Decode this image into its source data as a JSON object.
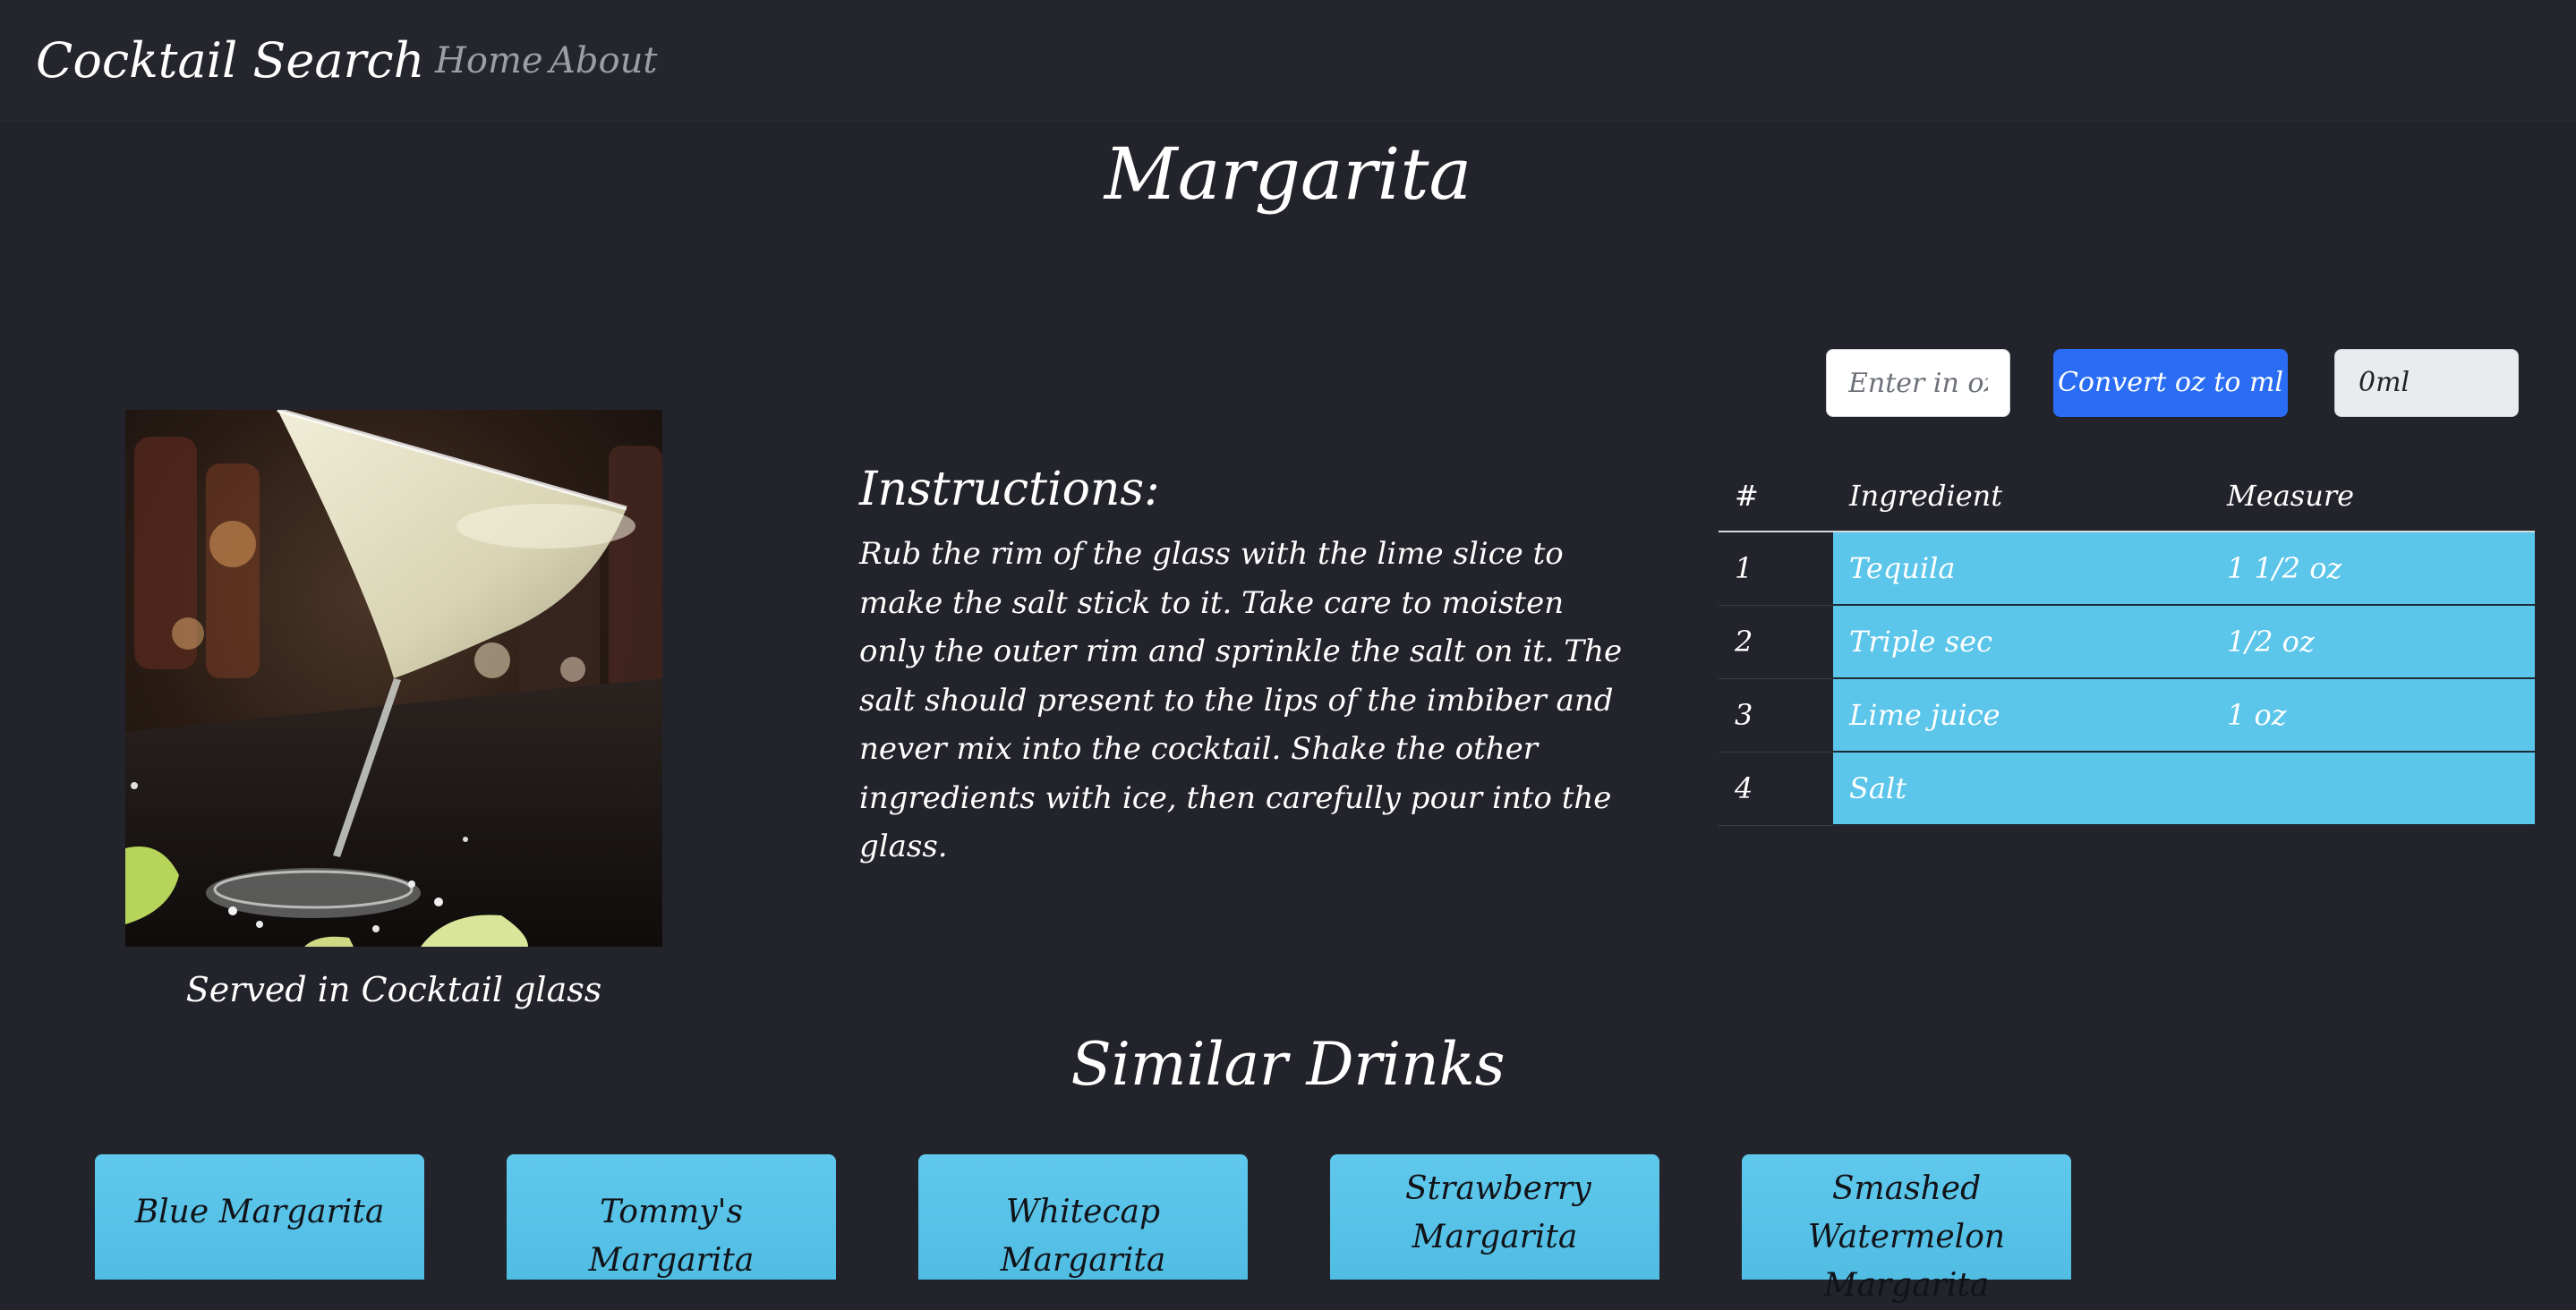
{
  "navbar": {
    "brand": "Cocktail Search",
    "links": [
      "Home",
      "About"
    ]
  },
  "drink": {
    "name": "Margarita",
    "served_in": "Served in Cocktail glass",
    "image_alt": "Margarita in cocktail glass"
  },
  "converter": {
    "input_placeholder": "Enter in oz",
    "button_label": "Convert oz to ml",
    "output_value": "0ml"
  },
  "instructions": {
    "heading": "Instructions:",
    "text": "Rub the rim of the glass with the lime slice to make the salt stick to it. Take care to moisten only the outer rim and sprinkle the salt on it. The salt should present to the lips of the imbiber and never mix into the cocktail. Shake the other ingredients with ice, then carefully pour into the glass."
  },
  "ingredients_table": {
    "headers": [
      "#",
      "Ingredient",
      "Measure"
    ],
    "rows": [
      {
        "num": "1",
        "ingredient": "Tequila",
        "measure": "1 1/2 oz"
      },
      {
        "num": "2",
        "ingredient": "Triple sec",
        "measure": "1/2 oz"
      },
      {
        "num": "3",
        "ingredient": "Lime juice",
        "measure": "1 oz"
      },
      {
        "num": "4",
        "ingredient": "Salt",
        "measure": ""
      }
    ]
  },
  "similar": {
    "heading": "Similar Drinks",
    "drinks": [
      "Blue Margarita",
      "Tommy's Margarita",
      "Whitecap Margarita",
      "Strawberry Margarita",
      "Smashed Watermelon Margarita"
    ]
  },
  "colors": {
    "background": "#22232b",
    "navbar": "#24252d",
    "accent_blue": "#2a6df4",
    "table_cell": "#5bc5ea",
    "nav_link": "#9c9ea6"
  }
}
